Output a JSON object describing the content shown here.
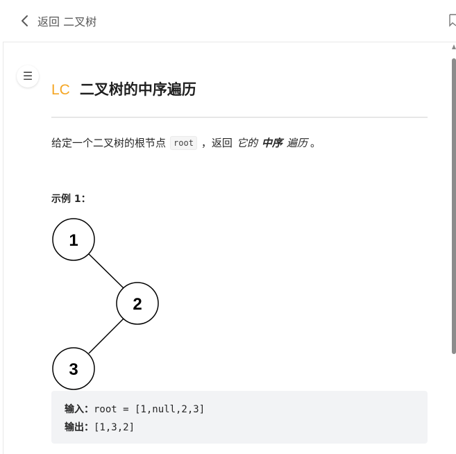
{
  "nav": {
    "back_label": "返回 二叉树"
  },
  "problem": {
    "badge": "LC",
    "title": "二叉树的中序遍历",
    "desc_before": "给定一个二叉树的根节点",
    "desc_code": "root",
    "desc_after": "，返回",
    "desc_em1": "它的",
    "desc_strong": "中序",
    "desc_em2": "遍历",
    "desc_end": "。"
  },
  "example": {
    "title": "示例 1：",
    "nodes": [
      "1",
      "2",
      "3"
    ],
    "input_label": "输入：",
    "input_value": "root = [1,null,2,3]",
    "output_label": "输出：",
    "output_value": "[1,3,2]"
  },
  "icons": {
    "back": "chevron-left-icon",
    "bookmark": "bookmark-icon",
    "toc": "menu-icon"
  },
  "colors": {
    "accent": "#f5a623",
    "code_bg": "#f2f3f5"
  }
}
